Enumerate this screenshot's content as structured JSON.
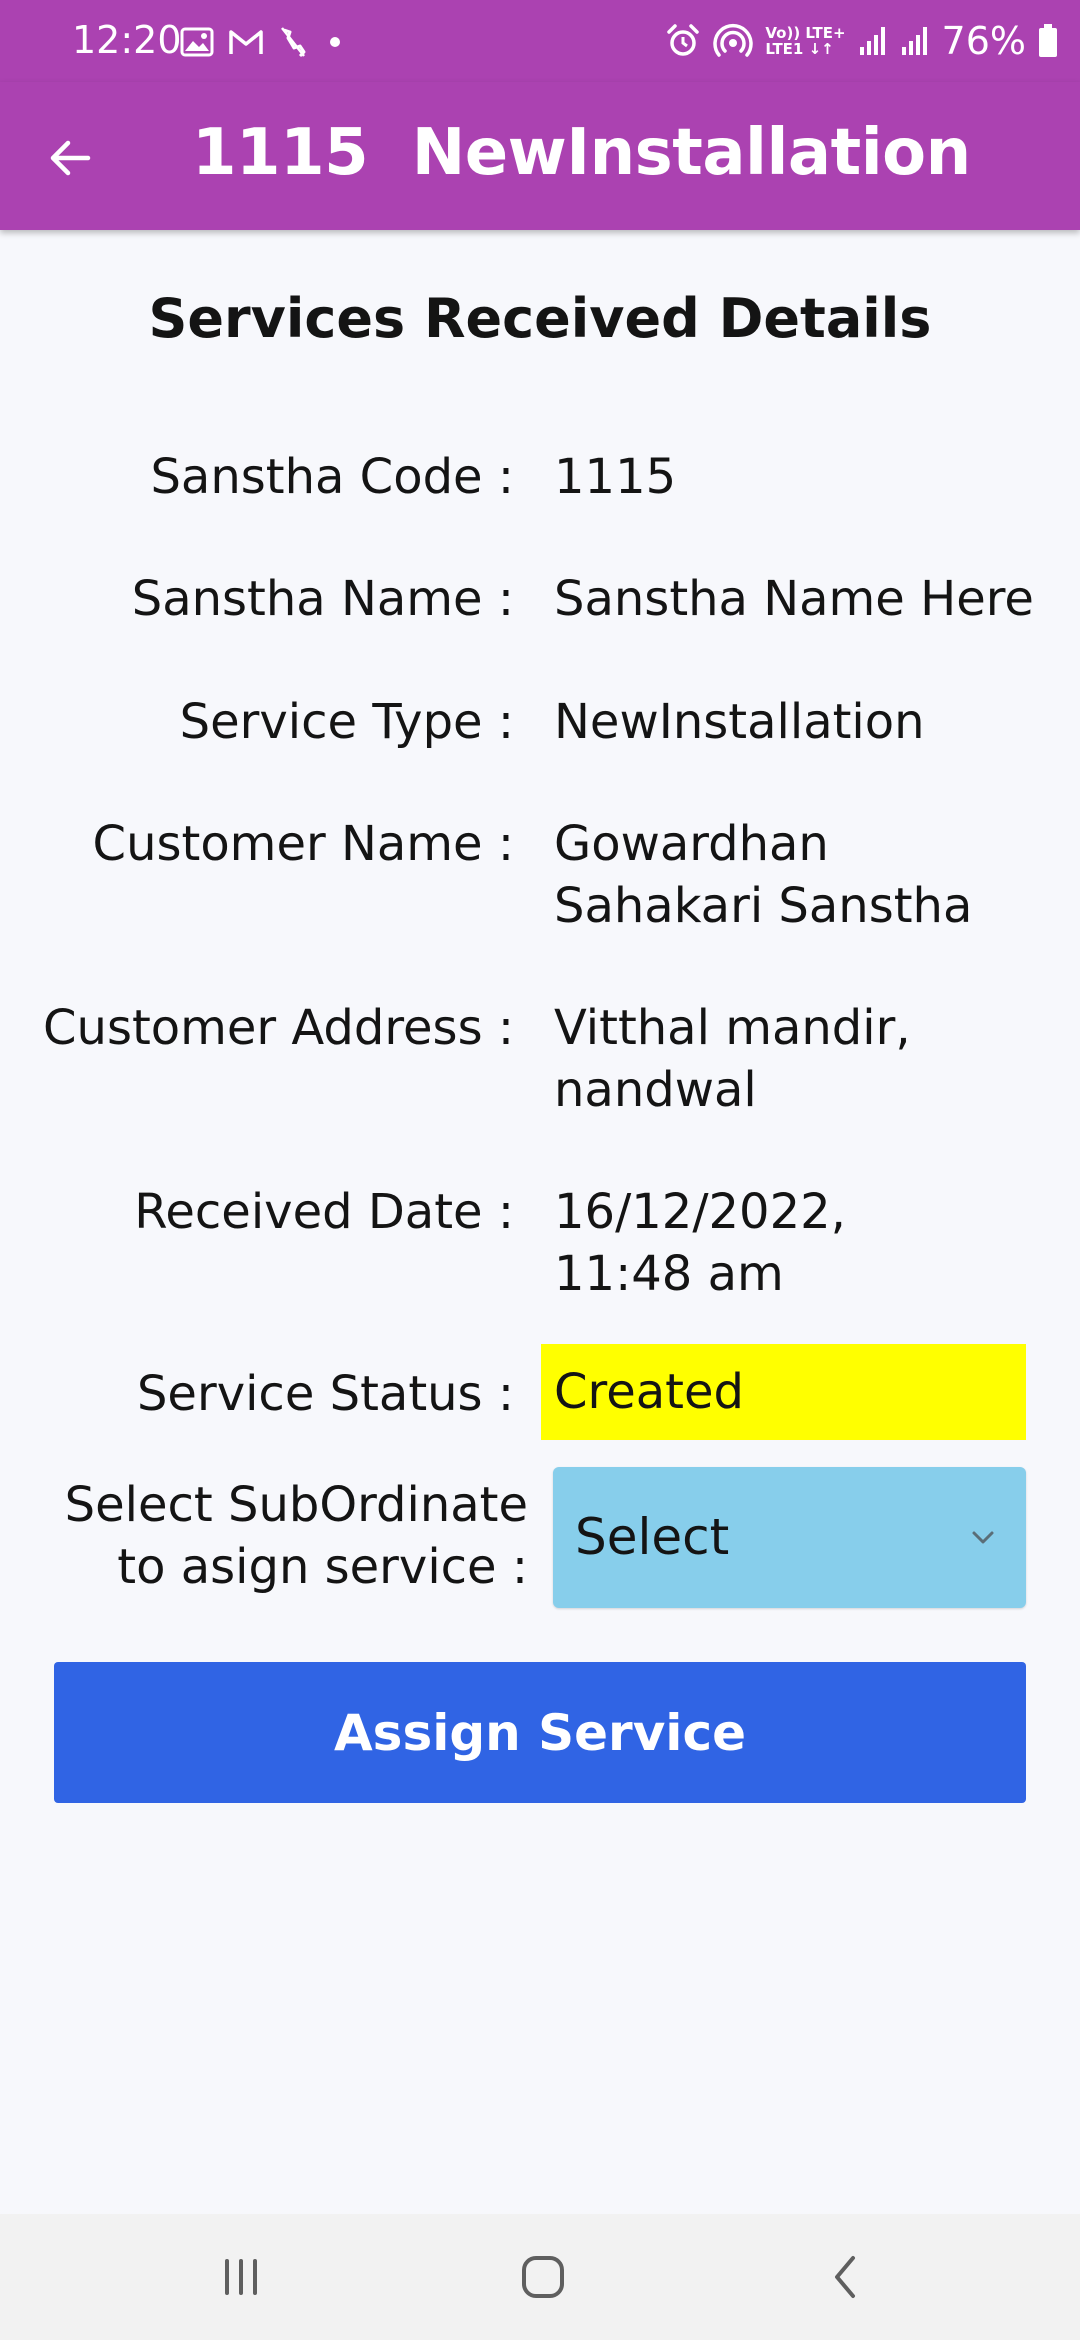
{
  "status_bar": {
    "time": "12:20",
    "battery": "76%",
    "lte_top": "Vo)) LTE+",
    "lte_bottom": "LTE1 ↓↑"
  },
  "app_bar": {
    "title": "1115  NewInstallation",
    "back_icon": "arrow-left-icon"
  },
  "page": {
    "title": "Services Received Details"
  },
  "details": [
    {
      "label": "Sanstha Code :",
      "value": "1115"
    },
    {
      "label": "Sanstha Name :",
      "value": "Sanstha Name Here"
    },
    {
      "label": "Service Type :",
      "value": "NewInstallation"
    },
    {
      "label": "Customer Name :",
      "value": "Gowardhan Sahakari Sanstha"
    },
    {
      "label": "Customer Address :",
      "value": "Vitthal mandir, nandwal"
    },
    {
      "label": "Received Date :",
      "value": "16/12/2022, 11:48 am"
    },
    {
      "label": "Service Status :",
      "value": "Created"
    }
  ],
  "subordinate": {
    "label_line1": "Select SubOrdinate",
    "label_line2": "to asign service :",
    "selected": "Select"
  },
  "assign_button": {
    "label": "Assign Service"
  },
  "colors": {
    "app_bar": "#ab42b1",
    "status_highlight": "#ffff00",
    "select_background": "#87ceeb",
    "button": "#3064e4",
    "page_background": "#f7f8fc"
  }
}
